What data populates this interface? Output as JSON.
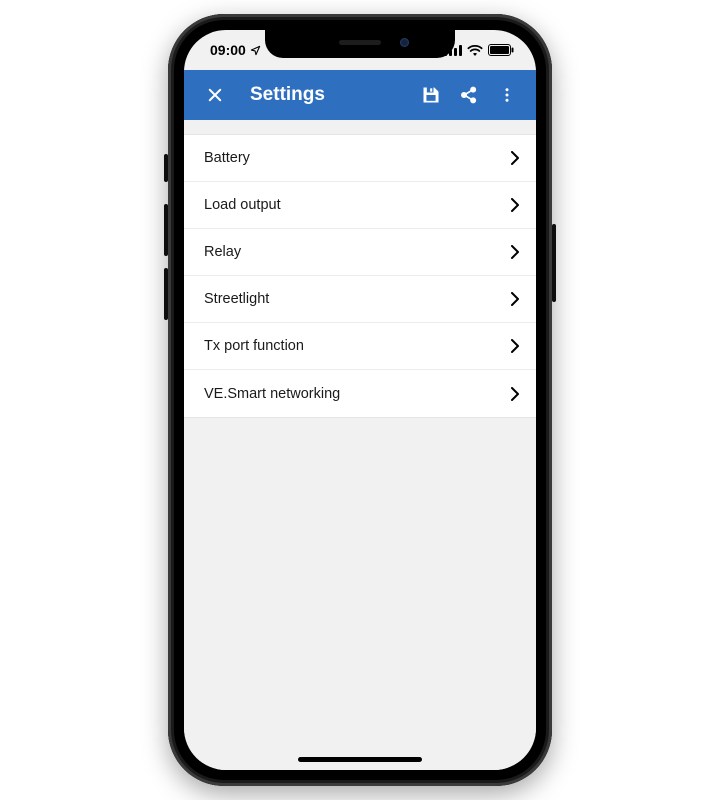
{
  "statusbar": {
    "time": "09:00"
  },
  "appbar": {
    "title": "Settings"
  },
  "menu": {
    "items": [
      {
        "label": "Battery"
      },
      {
        "label": "Load output"
      },
      {
        "label": "Relay"
      },
      {
        "label": "Streetlight"
      },
      {
        "label": "Tx port function"
      },
      {
        "label": "VE.Smart networking"
      }
    ]
  },
  "colors": {
    "appbar": "#2f6fc0",
    "screen_bg": "#f1f1f1",
    "row_bg": "#ffffff",
    "divider": "#ececec"
  }
}
